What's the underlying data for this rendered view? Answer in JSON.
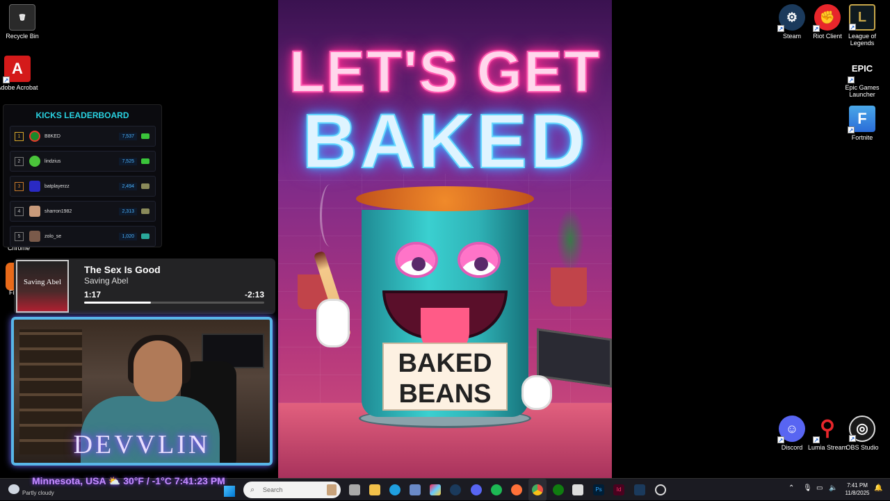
{
  "desktop_icons_left": [
    {
      "label": "Recycle Bin",
      "icon": "recycle-bin-icon"
    },
    {
      "label": "Adobe Acrobat",
      "icon": "acrobat-icon"
    }
  ],
  "desktop_icons_right": [
    {
      "label": "Steam",
      "icon": "steam-icon"
    },
    {
      "label": "Riot Client",
      "icon": "riot-icon"
    },
    {
      "label": "League of Legends",
      "icon": "league-icon"
    },
    {
      "label": "Epic Games Launcher",
      "icon": "epic-icon"
    },
    {
      "label": "Fortnite",
      "icon": "fortnite-icon"
    },
    {
      "label": "Discord",
      "icon": "discord-icon"
    },
    {
      "label": "Lumia Stream",
      "icon": "lumia-icon"
    },
    {
      "label": "OBS Studio",
      "icon": "obs-icon"
    }
  ],
  "partial_icons": {
    "chrome": "Chrome",
    "fi": "Fi"
  },
  "poster": {
    "line1": "LET'S GET",
    "line2": "BAKED",
    "can_label_1": "BAKED",
    "can_label_2": "BEANS",
    "colors": {
      "neon_pink": "#ff2d95",
      "neon_blue": "#35b8ff",
      "can_teal": "#3ad0d0"
    }
  },
  "leaderboard": {
    "title": "KICKS LEADERBOARD",
    "rows": [
      {
        "rank": "1",
        "name": "B8KED",
        "score": "7,537"
      },
      {
        "rank": "2",
        "name": "lindzius",
        "score": "7,525"
      },
      {
        "rank": "3",
        "name": "batplayerzz",
        "score": "2,494"
      },
      {
        "rank": "4",
        "name": "sharron1982",
        "score": "2,313"
      },
      {
        "rank": "5",
        "name": "zolo_se",
        "score": "1,020"
      }
    ]
  },
  "now_playing": {
    "title": "The Sex Is Good",
    "artist": "Saving Abel",
    "album_art_text": "Saving Abel",
    "elapsed": "1:17",
    "remaining": "-2:13",
    "progress": 0.37
  },
  "webcam": {
    "overlay_name": "DEVVLIN"
  },
  "weather_overlay": "Minnesota, USA ⛅ 30°F / -1°C  7:41:23 PM",
  "taskbar": {
    "weather_text": "Partly cloudy",
    "search_placeholder": "Search",
    "time": "7:41 PM",
    "date": "11/8/2025"
  }
}
